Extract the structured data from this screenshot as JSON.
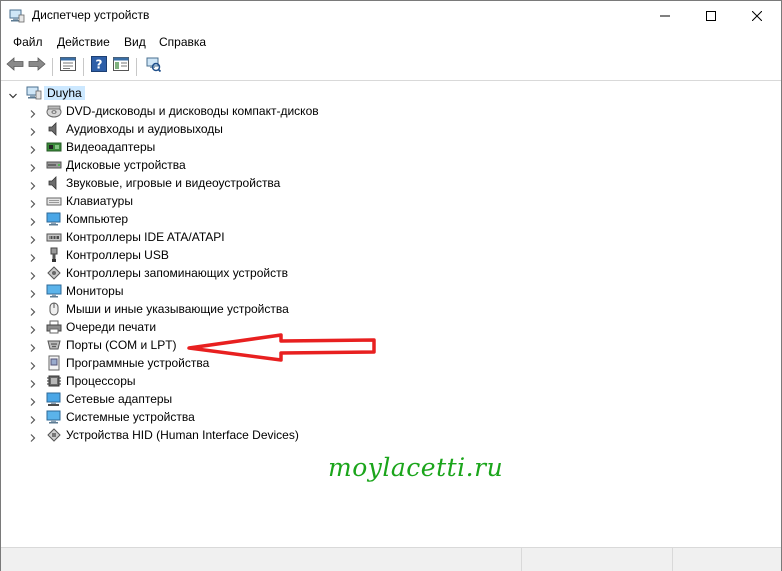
{
  "window": {
    "title": "Диспетчер устройств",
    "controls": {
      "minimize": "minimize-icon",
      "maximize": "maximize-icon",
      "close": "close-icon"
    }
  },
  "menu": [
    "Файл",
    "Действие",
    "Вид",
    "Справка"
  ],
  "toolbar": [
    "back-arrow-icon",
    "forward-arrow-icon",
    "properties-icon",
    "help-icon",
    "show-hide-console-tree-icon",
    "scan-hardware-icon"
  ],
  "tree": {
    "root": "Duyha",
    "items": [
      {
        "label": "DVD-дисководы и дисководы компакт-дисков",
        "icon": "dvd-drive-icon"
      },
      {
        "label": "Аудиовходы и аудиовыходы",
        "icon": "speaker-icon"
      },
      {
        "label": "Видеоадаптеры",
        "icon": "display-adapter-icon"
      },
      {
        "label": "Дисковые устройства",
        "icon": "disk-drive-icon"
      },
      {
        "label": "Звуковые, игровые и видеоустройства",
        "icon": "speaker-icon"
      },
      {
        "label": "Клавиатуры",
        "icon": "keyboard-icon"
      },
      {
        "label": "Компьютер",
        "icon": "computer-icon"
      },
      {
        "label": "Контроллеры IDE ATA/ATAPI",
        "icon": "ide-controller-icon"
      },
      {
        "label": "Контроллеры USB",
        "icon": "usb-icon"
      },
      {
        "label": "Контроллеры запоминающих устройств",
        "icon": "storage-controller-icon"
      },
      {
        "label": "Мониторы",
        "icon": "monitor-icon"
      },
      {
        "label": "Мыши и иные указывающие устройства",
        "icon": "mouse-icon"
      },
      {
        "label": "Очереди печати",
        "icon": "printer-icon"
      },
      {
        "label": "Порты (COM и LPT)",
        "icon": "port-icon"
      },
      {
        "label": "Программные устройства",
        "icon": "software-device-icon"
      },
      {
        "label": "Процессоры",
        "icon": "processor-icon"
      },
      {
        "label": "Сетевые адаптеры",
        "icon": "network-adapter-icon"
      },
      {
        "label": "Системные устройства",
        "icon": "system-device-icon"
      },
      {
        "label": "Устройства HID (Human Interface Devices)",
        "icon": "hid-icon"
      }
    ]
  },
  "overlay": {
    "watermark": "moylacetti.ru",
    "annotation_arrow": "red-arrow-icon",
    "arrow_color": "#e82020",
    "watermark_color": "#1ba51b"
  },
  "colors": {
    "selection": "#cce8ff",
    "icon_blue": "#1f6fc1"
  }
}
